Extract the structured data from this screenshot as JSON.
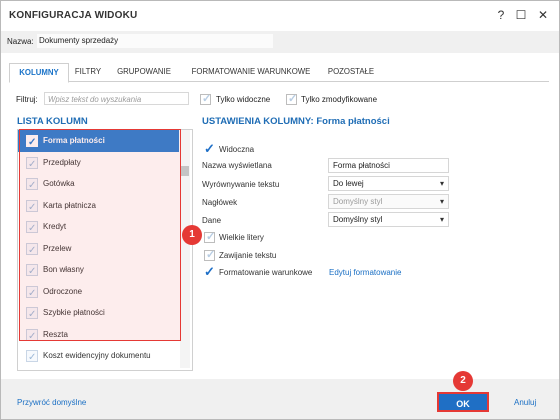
{
  "window": {
    "title": "KONFIGURACJA WIDOKU",
    "help_label": "?",
    "maximize_label": "☐",
    "close_label": "✕"
  },
  "name_field": {
    "label": "Nazwa:",
    "value": "Dokumenty sprzedaży"
  },
  "tabs": [
    {
      "label": "KOLUMNY",
      "active": true
    },
    {
      "label": "FILTRY",
      "active": false
    },
    {
      "label": "GRUPOWANIE",
      "active": false
    },
    {
      "label": "FORMATOWANIE WARUNKOWE",
      "active": false
    },
    {
      "label": "POZOSTAŁE",
      "active": false
    }
  ],
  "filter": {
    "label": "Filtruj:",
    "placeholder": "Wpisz tekst do wyszukania",
    "only_visible_label": "Tylko widoczne",
    "only_modified_label": "Tylko zmodyfikowane"
  },
  "column_list": {
    "title": "LISTA KOLUMN",
    "items": [
      {
        "label": "Forma płatności",
        "selected": true,
        "checked": true
      },
      {
        "label": "Przedpłaty",
        "selected": false,
        "checked": true
      },
      {
        "label": "Gotówka",
        "selected": false,
        "checked": true
      },
      {
        "label": "Karta płatnicza",
        "selected": false,
        "checked": true
      },
      {
        "label": "Kredyt",
        "selected": false,
        "checked": true
      },
      {
        "label": "Przelew",
        "selected": false,
        "checked": true
      },
      {
        "label": "Bon własny",
        "selected": false,
        "checked": true
      },
      {
        "label": "Odroczone",
        "selected": false,
        "checked": true
      },
      {
        "label": "Szybkie płatności",
        "selected": false,
        "checked": true
      },
      {
        "label": "Reszta",
        "selected": false,
        "checked": true
      },
      {
        "label": "Koszt ewidencyjny dokumentu",
        "selected": false,
        "checked": true
      }
    ]
  },
  "column_settings": {
    "title": "USTAWIENIA KOLUMNY: Forma płatności",
    "visible_label": "Widoczna",
    "visible_checked": true,
    "display_name_label": "Nazwa wyświetlana",
    "display_name_value": "Forma płatności",
    "alignment_label": "Wyrównywanie tekstu",
    "alignment_value": "Do lewej",
    "header_label": "Nagłówek",
    "header_value": "Domyślny styl",
    "data_label": "Dane",
    "data_value": "Domyślny styl",
    "uppercase_label": "Wielkie litery",
    "uppercase_checked": false,
    "wrap_label": "Zawijanie tekstu",
    "wrap_checked": false,
    "conditional_label": "Formatowanie warunkowe",
    "conditional_checked": true,
    "edit_formatting_label": "Edytuj formatowanie"
  },
  "annotations": {
    "badge1": "1",
    "badge2": "2"
  },
  "footer": {
    "restore_label": "Przywróć domyślne",
    "ok_label": "OK",
    "cancel_label": "Anuluj"
  },
  "colors": {
    "accent": "#1f6fc5",
    "highlight": "#e53935",
    "section_title": "#1f6db5"
  }
}
